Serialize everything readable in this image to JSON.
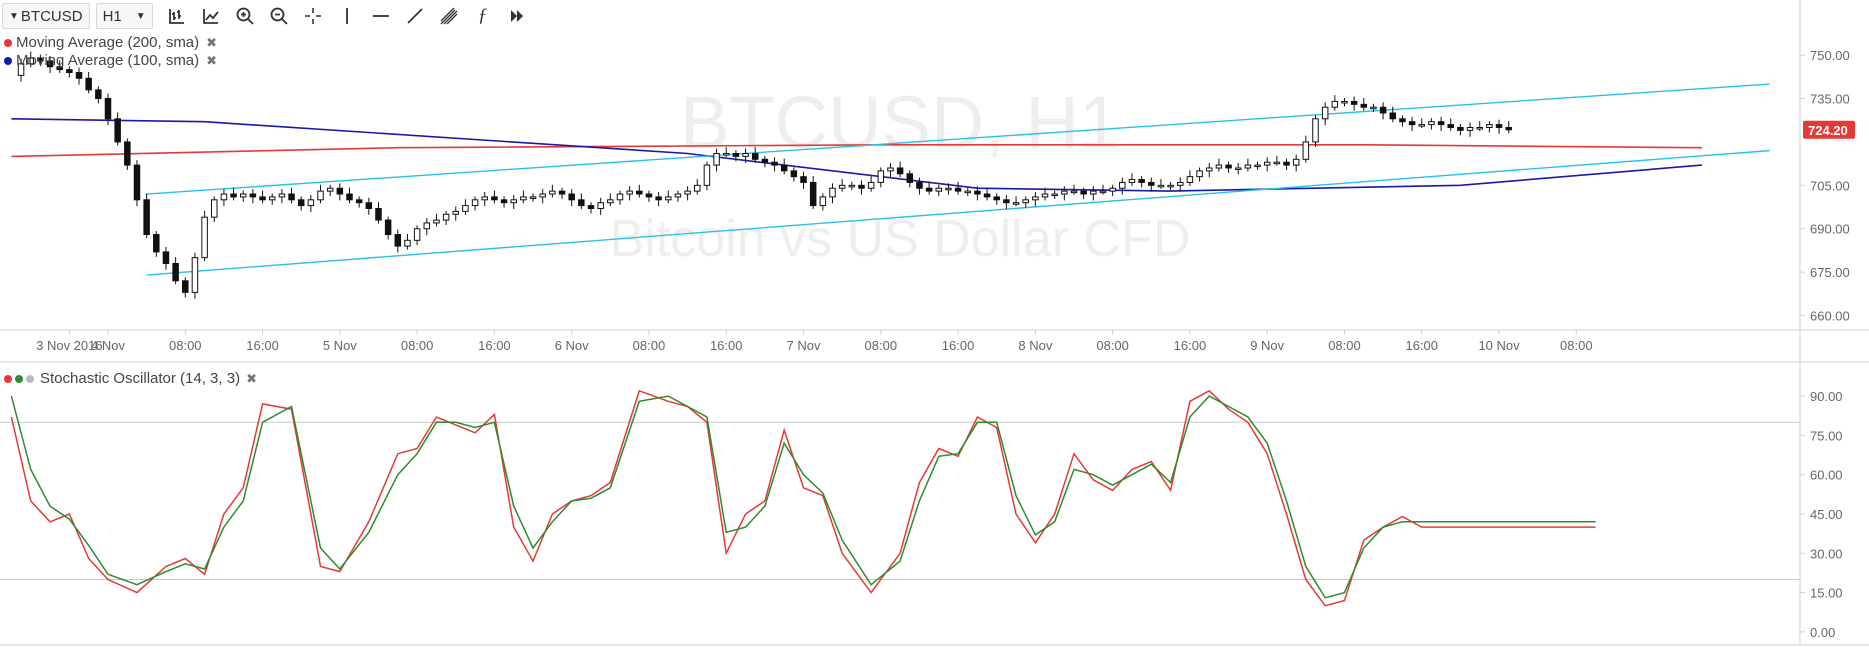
{
  "toolbar": {
    "symbol": "BTCUSD",
    "interval": "H1",
    "icons": [
      "bar-style-icon",
      "add-indicator-icon",
      "zoom-in-icon",
      "zoom-out-icon",
      "crosshair-icon",
      "vertical-line-icon",
      "horizontal-line-icon",
      "trend-line-icon",
      "pitchfork-icon",
      "fibonacci-icon",
      "more-tools-icon"
    ]
  },
  "legend": {
    "ma200": "Moving Average (200, sma)",
    "ma100": "Moving Average (100, sma)",
    "stoch": "Stochastic Oscillator (14, 3, 3)"
  },
  "watermark": {
    "symbol": "BTCUSD, H1",
    "description": "Bitcoin vs US Dollar CFD"
  },
  "colors": {
    "ma200": "#e53935",
    "ma100": "#1a1aa8",
    "channel": "#27c2e8",
    "stoch_k": "#e53935",
    "stoch_d": "#2e8b2e",
    "price_label_bg": "#e53935"
  },
  "chart_data": [
    {
      "type": "candlestick",
      "symbol": "BTCUSD",
      "interval": "H1",
      "y_axis_ticks": [
        750.0,
        735.0,
        724.2,
        705.0,
        690.0,
        675.0,
        660.0
      ],
      "ylim": [
        655,
        758
      ],
      "x_tick_labels": [
        "3 Nov 2016",
        "4 Nov",
        "08:00",
        "16:00",
        "5 Nov",
        "08:00",
        "16:00",
        "6 Nov",
        "08:00",
        "16:00",
        "7 Nov",
        "08:00",
        "16:00",
        "8 Nov",
        "08:00",
        "16:00",
        "9 Nov",
        "08:00",
        "16:00",
        "10 Nov",
        "08:00"
      ],
      "x_tick_hours": [
        -4,
        0,
        8,
        16,
        24,
        32,
        40,
        48,
        56,
        64,
        72,
        80,
        88,
        96,
        104,
        112,
        120,
        128,
        136,
        144,
        152
      ],
      "last_price": 724.2,
      "close_series_hourly_from_hour_-10": [
        743,
        747,
        749,
        748,
        746,
        745,
        744,
        742,
        738,
        735,
        728,
        720,
        712,
        700,
        688,
        682,
        678,
        672,
        668,
        680,
        694,
        700,
        702,
        701,
        702,
        701,
        700,
        701,
        702,
        700,
        698,
        700,
        703,
        704,
        702,
        700,
        699,
        697,
        693,
        688,
        684,
        686,
        690,
        692,
        693,
        695,
        696,
        698,
        700,
        701,
        700,
        699,
        700,
        701,
        701,
        702,
        703,
        702,
        700,
        698,
        697,
        699,
        700,
        702,
        703,
        702,
        701,
        700,
        701,
        702,
        703,
        705,
        712,
        716,
        716,
        715,
        716,
        714,
        713,
        712,
        710,
        708,
        706,
        698,
        701,
        704,
        705,
        705,
        704,
        706,
        710,
        711,
        709,
        706,
        704,
        703,
        704,
        704,
        703,
        703,
        702,
        701,
        700,
        699,
        699,
        700,
        701,
        702,
        702,
        703,
        703,
        702,
        703,
        703,
        704,
        706,
        707,
        706,
        705,
        705,
        705,
        706,
        708,
        710,
        711,
        712,
        711,
        711,
        712,
        712,
        713,
        713,
        712,
        714,
        720,
        728,
        732,
        734,
        734,
        733,
        732,
        732,
        730,
        728,
        727,
        726,
        726,
        727,
        726,
        725,
        724,
        725,
        725,
        726,
        725,
        724.2
      ],
      "moving_averages": {
        "sma200": {
          "hours": [
            -10,
            30,
            80,
            130,
            165
          ],
          "values": [
            715,
            718,
            719,
            719,
            718
          ]
        },
        "sma100": {
          "hours": [
            -10,
            10,
            60,
            90,
            110,
            140,
            165
          ],
          "values": [
            728,
            727,
            716,
            704,
            703,
            705,
            712
          ]
        }
      },
      "channel_lines": [
        {
          "from": {
            "hour": 4,
            "price": 702
          },
          "to": {
            "hour": 172,
            "price": 740
          }
        },
        {
          "from": {
            "hour": 4,
            "price": 674
          },
          "to": {
            "hour": 172,
            "price": 717
          }
        }
      ]
    },
    {
      "type": "line",
      "title": "Stochastic Oscillator (14, 3, 3)",
      "y_axis_ticks": [
        90.0,
        75.0,
        60.0,
        45.0,
        30.0,
        15.0,
        0.0
      ],
      "ylim": [
        -5,
        103
      ],
      "reference_lines": [
        80,
        20
      ],
      "series": [
        {
          "name": "%K",
          "color": "#e53935",
          "hours": [
            -10,
            -8,
            -6,
            -4,
            -2,
            0,
            3,
            6,
            8,
            10,
            12,
            14,
            16,
            19,
            22,
            24,
            27,
            30,
            32,
            34,
            36,
            38,
            40,
            42,
            44,
            46,
            48,
            50,
            52,
            55,
            58,
            60,
            62,
            64,
            66,
            68,
            70,
            72,
            74,
            76,
            79,
            82,
            84,
            86,
            88,
            90,
            92,
            94,
            96,
            98,
            100,
            102,
            104,
            106,
            108,
            110,
            112,
            114,
            116,
            118,
            120,
            122,
            124,
            126,
            128,
            130,
            132,
            134,
            136,
            138,
            140,
            142,
            144,
            146,
            148,
            150,
            152,
            154
          ],
          "values": [
            82,
            50,
            42,
            45,
            28,
            20,
            15,
            25,
            28,
            22,
            45,
            55,
            87,
            85,
            25,
            23,
            42,
            68,
            70,
            82,
            79,
            76,
            83,
            40,
            27,
            45,
            50,
            52,
            57,
            92,
            88,
            86,
            80,
            30,
            45,
            50,
            77,
            55,
            52,
            30,
            15,
            30,
            57,
            70,
            67,
            82,
            78,
            45,
            34,
            45,
            68,
            58,
            54,
            62,
            65,
            54,
            88,
            92,
            85,
            80,
            68,
            45,
            20,
            10,
            12,
            35,
            40,
            44,
            40,
            40,
            40,
            40,
            40,
            40,
            40,
            40,
            40,
            40
          ]
        },
        {
          "name": "%D",
          "color": "#2e8b2e",
          "hours": [
            -10,
            -8,
            -6,
            -4,
            -2,
            0,
            3,
            6,
            8,
            10,
            12,
            14,
            16,
            19,
            22,
            24,
            27,
            30,
            32,
            34,
            36,
            38,
            40,
            42,
            44,
            46,
            48,
            50,
            52,
            55,
            58,
            60,
            62,
            64,
            66,
            68,
            70,
            72,
            74,
            76,
            79,
            82,
            84,
            86,
            88,
            90,
            92,
            94,
            96,
            98,
            100,
            102,
            104,
            106,
            108,
            110,
            112,
            114,
            116,
            118,
            120,
            122,
            124,
            126,
            128,
            130,
            132,
            134,
            136,
            138,
            140,
            142,
            144,
            146,
            148,
            150,
            152,
            154
          ],
          "values": [
            90,
            62,
            48,
            43,
            33,
            22,
            18,
            23,
            26,
            24,
            40,
            50,
            80,
            86,
            32,
            24,
            38,
            60,
            68,
            80,
            80,
            78,
            80,
            48,
            32,
            42,
            50,
            51,
            55,
            88,
            90,
            86,
            82,
            38,
            40,
            48,
            72,
            60,
            53,
            35,
            18,
            27,
            50,
            67,
            68,
            80,
            80,
            52,
            37,
            42,
            62,
            60,
            56,
            60,
            64,
            57,
            82,
            90,
            86,
            82,
            72,
            50,
            25,
            13,
            15,
            32,
            40,
            42,
            42,
            42,
            42,
            42,
            42,
            42,
            42,
            42,
            42,
            42
          ]
        }
      ]
    }
  ]
}
